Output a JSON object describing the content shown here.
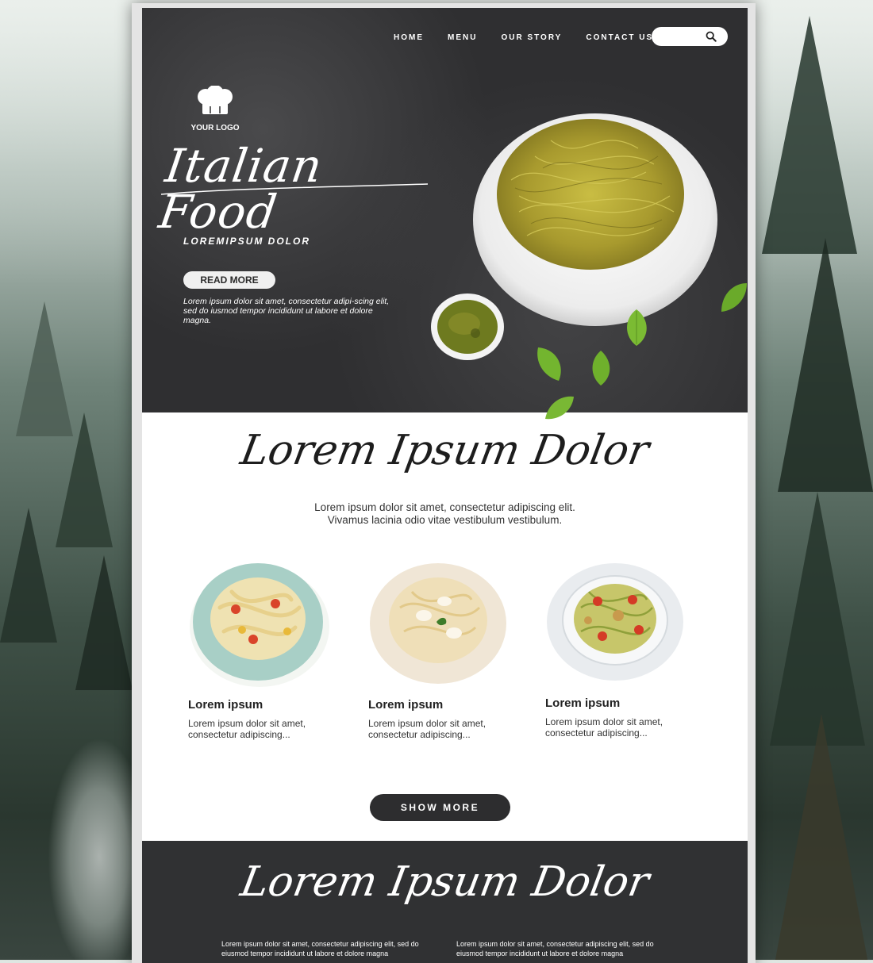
{
  "nav": {
    "items": [
      "HOME",
      "MENU",
      "OUR STORY",
      "CONTACT US"
    ],
    "search_placeholder": ""
  },
  "hero": {
    "logo_text": "YOUR LOGO",
    "title": "Italian Food",
    "subtitle": "LOREMIPSUM DOLOR",
    "button": "READ MORE",
    "text": "Lorem ipsum dolor sit amet, consectetur adipi-scing elit, sed do iusmod tempor incididunt ut labore et dolore magna."
  },
  "section": {
    "title": "Lorem Ipsum Dolor",
    "text_line1": "Lorem ipsum dolor sit amet, consectetur adipiscing elit.",
    "text_line2": "Vivamus lacinia odio vitae vestibulum vestibulum.",
    "dishes": [
      {
        "title": "Lorem ipsum",
        "desc": "Lorem ipsum dolor sit amet, consectetur  adipiscing..."
      },
      {
        "title": "Lorem ipsum",
        "desc": "Lorem ipsum dolor sit amet, consectetur  adipiscing..."
      },
      {
        "title": "Lorem ipsum",
        "desc": "Lorem ipsum dolor sit amet, consectetur  adipiscing..."
      }
    ],
    "button": "SHOW MORE"
  },
  "footer": {
    "title": "Lorem Ipsum Dolor",
    "col1": "Lorem ipsum dolor sit amet, consectetur adipiscing elit, sed do eiusmod tempor incididunt ut labore et dolore magna",
    "col2": "Lorem ipsum dolor sit amet, consectetur adipiscing elit, sed do eiusmod tempor incididunt ut labore et dolore magna"
  },
  "colors": {
    "hero_bg": "#2f2f31",
    "footer_bg": "#303133",
    "button_dark": "#2d2d2f",
    "pesto": "#b9ad35",
    "basil": "#6aaa2a"
  }
}
